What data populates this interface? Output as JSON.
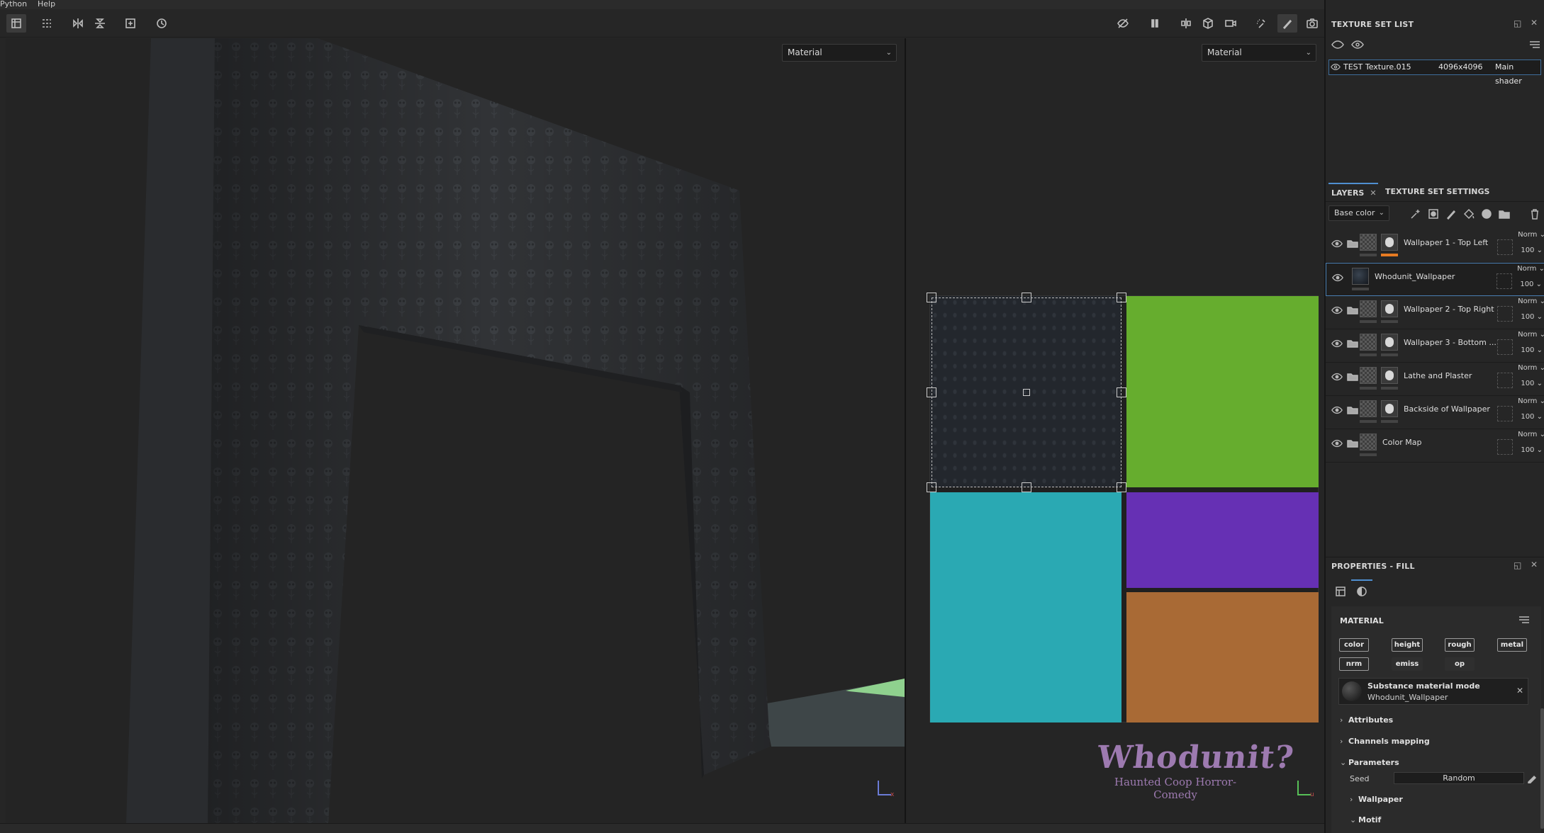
{
  "menu": {
    "items": [
      "Python",
      "Help"
    ]
  },
  "viewport3d": {
    "mode_dropdown": "Material"
  },
  "viewport2d": {
    "mode_dropdown": "Material",
    "uv_tiles": [
      {
        "name": "tile-wallpaper-top-left",
        "color": "#23272d"
      },
      {
        "name": "tile-top-right",
        "color": "#66ad2e"
      },
      {
        "name": "tile-bottom-left",
        "color": "#2aa9b3"
      },
      {
        "name": "tile-middle-right",
        "color": "#6630b4"
      },
      {
        "name": "tile-bottom-right",
        "color": "#a96a35"
      }
    ],
    "watermark": {
      "title": "Whodunit?",
      "subtitle": "Haunted Coop Horror-Comedy"
    }
  },
  "texture_set_list": {
    "title": "TEXTURE SET LIST",
    "row": {
      "name": "TEST Texture.015",
      "resolution": "4096x4096",
      "shader": "Main shader"
    }
  },
  "layers_panel": {
    "tabs": [
      "LAYERS",
      "TEXTURE SET SETTINGS"
    ],
    "channel_dropdown": "Base color",
    "rows": [
      {
        "name": "Wallpaper 1 - Top Left",
        "blend": "Norm",
        "opacity": "100",
        "group": true,
        "mask": true,
        "orange": true,
        "selected": false
      },
      {
        "name": "Whodunit_Wallpaper",
        "blend": "Norm",
        "opacity": "100",
        "group": false,
        "mask": false,
        "orange": false,
        "selected": true
      },
      {
        "name": "Wallpaper 2 - Top Right",
        "blend": "Norm",
        "opacity": "100",
        "group": true,
        "mask": true,
        "orange": false,
        "selected": false
      },
      {
        "name": "Wallpaper 3 - Bottom ...",
        "blend": "Norm",
        "opacity": "100",
        "group": true,
        "mask": true,
        "orange": false,
        "selected": false
      },
      {
        "name": "Lathe and Plaster",
        "blend": "Norm",
        "opacity": "100",
        "group": true,
        "mask": true,
        "orange": false,
        "selected": false
      },
      {
        "name": "Backside of Wallpaper",
        "blend": "Norm",
        "opacity": "100",
        "group": true,
        "mask": true,
        "orange": false,
        "selected": false
      },
      {
        "name": "Color Map",
        "blend": "Norm",
        "opacity": "100",
        "group": true,
        "mask": false,
        "orange": false,
        "selected": false
      }
    ]
  },
  "properties": {
    "title": "PROPERTIES - FILL",
    "material_label": "MATERIAL",
    "channels": [
      "color",
      "height",
      "rough",
      "metal",
      "nrm",
      "emiss",
      "op"
    ],
    "substance": {
      "title": "Substance material mode",
      "name": "Whodunit_Wallpaper"
    },
    "sections": {
      "attributes": "Attributes",
      "channels_mapping": "Channels mapping",
      "parameters": "Parameters",
      "wallpaper": "Wallpaper",
      "motif": "Motif"
    },
    "seed_label": "Seed",
    "seed_value": "Random"
  }
}
